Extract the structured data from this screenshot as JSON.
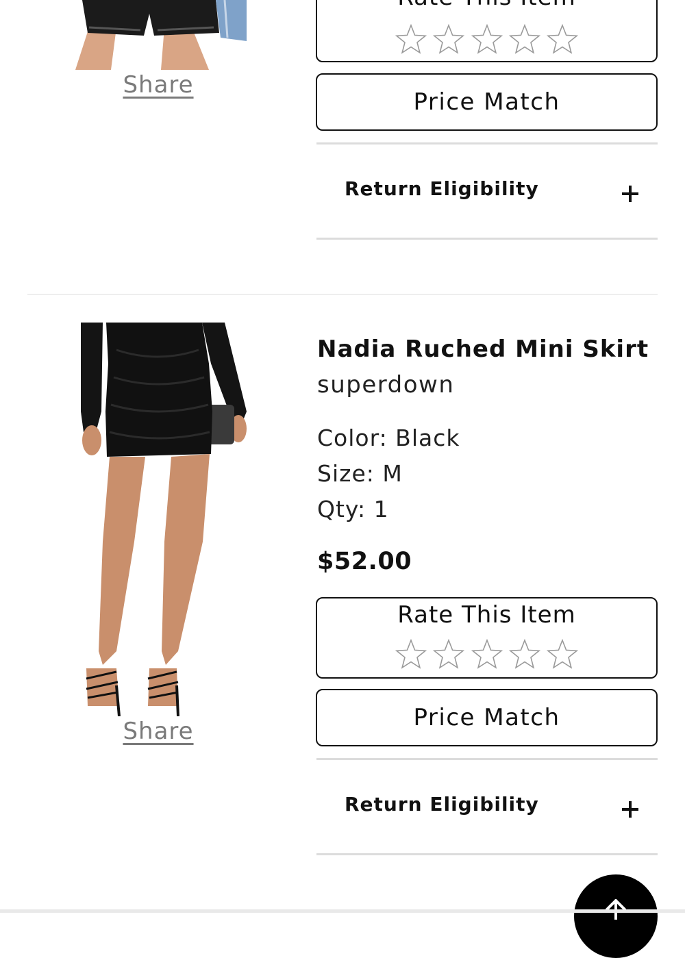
{
  "items": [
    {
      "image_alt": "leather shorts",
      "share_label": "Share",
      "rate_title": "Rate This Item",
      "rating": 0,
      "price_match_label": "Price Match",
      "return_label": "Return Eligibility"
    },
    {
      "image_alt": "black ruched mini skirt",
      "name": "Nadia Ruched Mini Skirt",
      "brand": "superdown",
      "color": "Color: Black",
      "size": "Size: M",
      "qty": "Qty: 1",
      "price": "$52.00",
      "share_label": "Share",
      "rate_title": "Rate This Item",
      "rating": 0,
      "price_match_label": "Price Match",
      "return_label": "Return Eligibility"
    }
  ],
  "icons": {
    "star": "star-outline-icon",
    "expand": "plus-icon",
    "scroll_top": "arrow-up-icon"
  },
  "colors": {
    "text": "#111111",
    "muted": "#7a7a7a",
    "star_outline": "#9a9a9a",
    "rule": "#dcdcdc",
    "button_bg": "#000000"
  }
}
